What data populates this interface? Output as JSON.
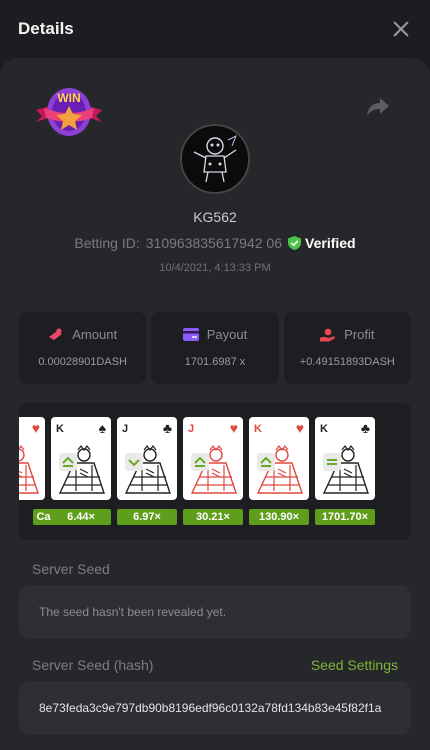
{
  "header": {
    "title": "Details"
  },
  "bet": {
    "username": "KG562",
    "betting_id_label": "Betting ID:",
    "betting_id": "310963835617942 06",
    "verified_label": "Verified",
    "date": "10/4/2021, 4:13:33 PM",
    "badge_text": "WIN"
  },
  "stats": [
    {
      "label": "Amount",
      "value": "0.00028901DASH",
      "icon": "coins-icon",
      "icon_color": "#e8496a"
    },
    {
      "label": "Payout",
      "value": "1701.6987 x",
      "icon": "card-wallet-icon",
      "icon_color": "#8b5cf6"
    },
    {
      "label": "Profit",
      "value": "+0.49151893DASH",
      "icon": "hand-coin-icon",
      "icon_color": "#e5484d"
    }
  ],
  "cards": [
    {
      "rank": "",
      "suit": "♥",
      "color": "#e0473f",
      "style": "red",
      "partial": true
    },
    {
      "rank": "K",
      "suit": "♠",
      "color": "#222222",
      "style": "dark"
    },
    {
      "rank": "J",
      "suit": "♣",
      "color": "#222222",
      "style": "dark"
    },
    {
      "rank": "J",
      "suit": "♥",
      "color": "#e0473f",
      "style": "red"
    },
    {
      "rank": "K",
      "suit": "♥",
      "color": "#e0473f",
      "style": "red"
    },
    {
      "rank": "K",
      "suit": "♣",
      "color": "#222222",
      "style": "dark"
    }
  ],
  "arrows": [
    "higher-arrow-icon",
    "lower-arrow-icon",
    "higher-arrow-icon",
    "higher-arrow-icon",
    "equal-icon"
  ],
  "multipliers": [
    "Card",
    "6.44×",
    "6.97×",
    "30.21×",
    "130.90×",
    "1701.70×"
  ],
  "server_seed": {
    "label": "Server Seed",
    "value": "The seed hasn't been revealed yet."
  },
  "server_seed_hash": {
    "label": "Server Seed (hash)",
    "value": "8e73feda3c9e797db90b8196edf96c0132a78fd134b83e45f82f1a",
    "settings_label": "Seed Settings"
  },
  "colors": {
    "accent_green": "#7fb537",
    "multiplier_bg": "#5f9d1c",
    "verified_green": "#4cc44a"
  }
}
